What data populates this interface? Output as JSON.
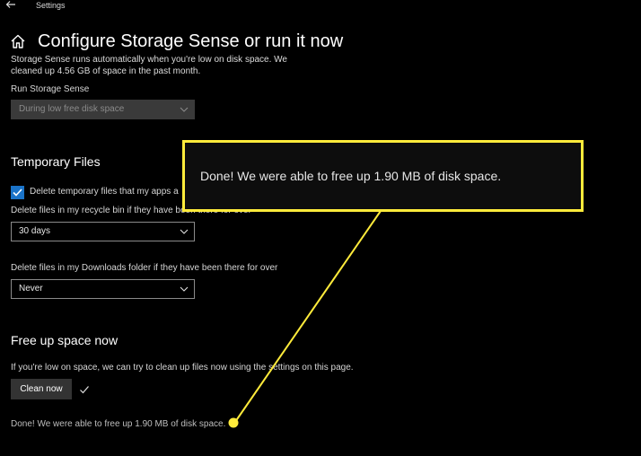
{
  "window": {
    "title": "Settings",
    "back_icon": "arrow-left-icon"
  },
  "header": {
    "home_icon": "home-icon",
    "title": "Configure Storage Sense or run it now"
  },
  "intro": {
    "text": "Storage Sense runs automatically when you're low on disk space. We cleaned up 4.56 GB of space in the past month."
  },
  "run_storage_sense": {
    "label": "Run Storage Sense",
    "selected": "During low free disk space",
    "disabled": true
  },
  "temporary_files": {
    "heading": "Temporary Files",
    "checkbox_label": "Delete temporary files that my apps a",
    "checkbox_checked": true,
    "recycle_bin_label": "Delete files in my recycle bin if they have been there for over",
    "recycle_bin_value": "30 days",
    "downloads_label": "Delete files in my Downloads folder if they have been there for over",
    "downloads_value": "Never"
  },
  "free_up": {
    "heading": "Free up space now",
    "description": "If you're low on space, we can try to clean up files now using the settings on this page.",
    "button_label": "Clean now",
    "status": "Done! We were able to free up 1.90 MB of disk space."
  },
  "callout": {
    "text": "Done! We were able to free up 1.90 MB of disk space.",
    "border_color": "#ffeb3b"
  },
  "colors": {
    "accent": "#1a73c8",
    "background": "#000000"
  }
}
